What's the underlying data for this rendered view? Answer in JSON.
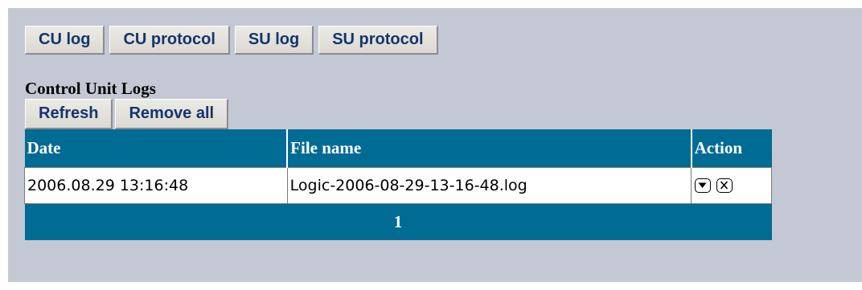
{
  "tabs": [
    "CU log",
    "CU protocol",
    "SU log",
    "SU protocol"
  ],
  "section_title": "Control Unit Logs",
  "actions": {
    "refresh_label": "Refresh",
    "remove_all_label": "Remove all"
  },
  "table": {
    "headers": [
      "Date",
      "File name",
      "Action"
    ],
    "rows": [
      {
        "date": "2006.08.29 13:16:48",
        "file_name": "Logic-2006-08-29-13-16-48.log",
        "action_icons": [
          "download-icon",
          "delete-icon"
        ]
      }
    ],
    "pager": "1"
  },
  "colors": {
    "background": "#c4c8d4",
    "header": "#006b93",
    "button_text": "#13356f"
  }
}
